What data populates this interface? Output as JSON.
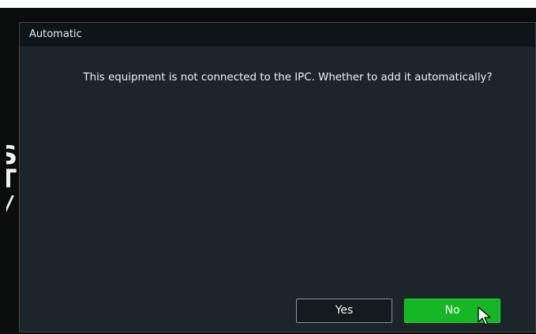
{
  "dialog": {
    "title": "Automatic",
    "message": "This equipment is not connected to the IPC. Whether to add it automatically?",
    "buttons": {
      "yes_label": "Yes",
      "no_label": "No"
    }
  },
  "background": {
    "partial_letters": [
      "S",
      "T"
    ]
  },
  "colors": {
    "dialog_bg": "#1b252a",
    "titlebar_bg": "#0e1518",
    "yes_button_bg": "#141b1e",
    "no_button_bg": "#15b824",
    "text": "#f0f2f3"
  },
  "icons": {
    "cursor": "mouse-pointer-icon"
  }
}
